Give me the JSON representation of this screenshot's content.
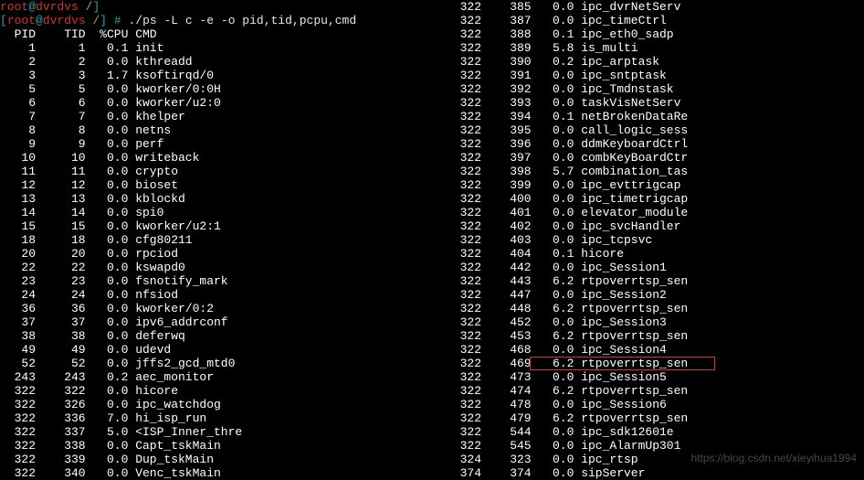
{
  "prompt": {
    "line0": {
      "user": "root",
      "at": "@",
      "host": "dvrdvs",
      "path": " /",
      "close": "]"
    },
    "line1": {
      "bracket_open": "[",
      "user": "root",
      "at": "@",
      "host": "dvrdvs",
      "path": " /",
      "bracket_close": "]",
      "hash": " # ",
      "command": "./ps -L c -e -o pid,tid,pcpu,cmd"
    }
  },
  "header": {
    "pid": "PID",
    "tid": "TID",
    "pcpu": "%CPU",
    "cmd": "CMD"
  },
  "left_rows": [
    {
      "pid": "1",
      "tid": "1",
      "pcpu": "0.1",
      "cmd": "init"
    },
    {
      "pid": "2",
      "tid": "2",
      "pcpu": "0.0",
      "cmd": "kthreadd"
    },
    {
      "pid": "3",
      "tid": "3",
      "pcpu": "1.7",
      "cmd": "ksoftirqd/0"
    },
    {
      "pid": "5",
      "tid": "5",
      "pcpu": "0.0",
      "cmd": "kworker/0:0H"
    },
    {
      "pid": "6",
      "tid": "6",
      "pcpu": "0.0",
      "cmd": "kworker/u2:0"
    },
    {
      "pid": "7",
      "tid": "7",
      "pcpu": "0.0",
      "cmd": "khelper"
    },
    {
      "pid": "8",
      "tid": "8",
      "pcpu": "0.0",
      "cmd": "netns"
    },
    {
      "pid": "9",
      "tid": "9",
      "pcpu": "0.0",
      "cmd": "perf"
    },
    {
      "pid": "10",
      "tid": "10",
      "pcpu": "0.0",
      "cmd": "writeback"
    },
    {
      "pid": "11",
      "tid": "11",
      "pcpu": "0.0",
      "cmd": "crypto"
    },
    {
      "pid": "12",
      "tid": "12",
      "pcpu": "0.0",
      "cmd": "bioset"
    },
    {
      "pid": "13",
      "tid": "13",
      "pcpu": "0.0",
      "cmd": "kblockd"
    },
    {
      "pid": "14",
      "tid": "14",
      "pcpu": "0.0",
      "cmd": "spi0"
    },
    {
      "pid": "15",
      "tid": "15",
      "pcpu": "0.0",
      "cmd": "kworker/u2:1"
    },
    {
      "pid": "18",
      "tid": "18",
      "pcpu": "0.0",
      "cmd": "cfg80211"
    },
    {
      "pid": "20",
      "tid": "20",
      "pcpu": "0.0",
      "cmd": "rpciod"
    },
    {
      "pid": "22",
      "tid": "22",
      "pcpu": "0.0",
      "cmd": "kswapd0"
    },
    {
      "pid": "23",
      "tid": "23",
      "pcpu": "0.0",
      "cmd": "fsnotify_mark"
    },
    {
      "pid": "24",
      "tid": "24",
      "pcpu": "0.0",
      "cmd": "nfsiod"
    },
    {
      "pid": "36",
      "tid": "36",
      "pcpu": "0.0",
      "cmd": "kworker/0:2"
    },
    {
      "pid": "37",
      "tid": "37",
      "pcpu": "0.0",
      "cmd": "ipv6_addrconf"
    },
    {
      "pid": "38",
      "tid": "38",
      "pcpu": "0.0",
      "cmd": "deferwq"
    },
    {
      "pid": "49",
      "tid": "49",
      "pcpu": "0.0",
      "cmd": "udevd"
    },
    {
      "pid": "52",
      "tid": "52",
      "pcpu": "0.0",
      "cmd": "jffs2_gcd_mtd0"
    },
    {
      "pid": "243",
      "tid": "243",
      "pcpu": "0.2",
      "cmd": "aec_monitor"
    },
    {
      "pid": "322",
      "tid": "322",
      "pcpu": "0.0",
      "cmd": "hicore"
    },
    {
      "pid": "322",
      "tid": "326",
      "pcpu": "0.0",
      "cmd": "ipc_watchdog"
    },
    {
      "pid": "322",
      "tid": "336",
      "pcpu": "7.0",
      "cmd": "hi_isp_run"
    },
    {
      "pid": "322",
      "tid": "337",
      "pcpu": "5.0",
      "cmd": "<ISP_Inner_thre"
    },
    {
      "pid": "322",
      "tid": "338",
      "pcpu": "0.0",
      "cmd": "Capt_tskMain"
    },
    {
      "pid": "322",
      "tid": "339",
      "pcpu": "0.0",
      "cmd": "Dup_tskMain"
    },
    {
      "pid": "322",
      "tid": "340",
      "pcpu": "0.0",
      "cmd": "Venc_tskMain"
    }
  ],
  "right_rows": [
    {
      "pid": "322",
      "tid": "385",
      "pcpu": "0.0",
      "cmd": "ipc_dvrNetServ"
    },
    {
      "pid": "322",
      "tid": "387",
      "pcpu": "0.0",
      "cmd": "ipc_timeCtrl"
    },
    {
      "pid": "322",
      "tid": "388",
      "pcpu": "0.1",
      "cmd": "ipc_eth0_sadp"
    },
    {
      "pid": "322",
      "tid": "389",
      "pcpu": "5.8",
      "cmd": "is_multi"
    },
    {
      "pid": "322",
      "tid": "390",
      "pcpu": "0.2",
      "cmd": "ipc_arptask"
    },
    {
      "pid": "322",
      "tid": "391",
      "pcpu": "0.0",
      "cmd": "ipc_sntptask"
    },
    {
      "pid": "322",
      "tid": "392",
      "pcpu": "0.0",
      "cmd": "ipc_Tmdnstask"
    },
    {
      "pid": "322",
      "tid": "393",
      "pcpu": "0.0",
      "cmd": "taskVisNetServ"
    },
    {
      "pid": "322",
      "tid": "394",
      "pcpu": "0.1",
      "cmd": "netBrokenDataRe"
    },
    {
      "pid": "322",
      "tid": "395",
      "pcpu": "0.0",
      "cmd": "call_logic_sess"
    },
    {
      "pid": "322",
      "tid": "396",
      "pcpu": "0.0",
      "cmd": "ddmKeyboardCtrl"
    },
    {
      "pid": "322",
      "tid": "397",
      "pcpu": "0.0",
      "cmd": "combKeyBoardCtr"
    },
    {
      "pid": "322",
      "tid": "398",
      "pcpu": "5.7",
      "cmd": "combination_tas"
    },
    {
      "pid": "322",
      "tid": "399",
      "pcpu": "0.0",
      "cmd": "ipc_evttrigcap"
    },
    {
      "pid": "322",
      "tid": "400",
      "pcpu": "0.0",
      "cmd": "ipc_timetrigcap"
    },
    {
      "pid": "322",
      "tid": "401",
      "pcpu": "0.0",
      "cmd": "elevator_module"
    },
    {
      "pid": "322",
      "tid": "402",
      "pcpu": "0.0",
      "cmd": "ipc_svcHandler"
    },
    {
      "pid": "322",
      "tid": "403",
      "pcpu": "0.0",
      "cmd": "ipc_tcpsvc"
    },
    {
      "pid": "322",
      "tid": "404",
      "pcpu": "0.1",
      "cmd": "hicore"
    },
    {
      "pid": "322",
      "tid": "442",
      "pcpu": "0.0",
      "cmd": "ipc_Session1"
    },
    {
      "pid": "322",
      "tid": "443",
      "pcpu": "6.2",
      "cmd": "rtpoverrtsp_sen"
    },
    {
      "pid": "322",
      "tid": "447",
      "pcpu": "0.0",
      "cmd": "ipc_Session2"
    },
    {
      "pid": "322",
      "tid": "448",
      "pcpu": "6.2",
      "cmd": "rtpoverrtsp_sen"
    },
    {
      "pid": "322",
      "tid": "452",
      "pcpu": "0.0",
      "cmd": "ipc_Session3"
    },
    {
      "pid": "322",
      "tid": "453",
      "pcpu": "6.2",
      "cmd": "rtpoverrtsp_sen"
    },
    {
      "pid": "322",
      "tid": "468",
      "pcpu": "0.0",
      "cmd": "ipc_Session4"
    },
    {
      "pid": "322",
      "tid": "469",
      "pcpu": "6.2",
      "cmd": "rtpoverrtsp_sen"
    },
    {
      "pid": "322",
      "tid": "473",
      "pcpu": "0.0",
      "cmd": "ipc_Session5"
    },
    {
      "pid": "322",
      "tid": "474",
      "pcpu": "6.2",
      "cmd": "rtpoverrtsp_sen"
    },
    {
      "pid": "322",
      "tid": "478",
      "pcpu": "0.0",
      "cmd": "ipc_Session6"
    },
    {
      "pid": "322",
      "tid": "479",
      "pcpu": "6.2",
      "cmd": "rtpoverrtsp_sen"
    },
    {
      "pid": "322",
      "tid": "544",
      "pcpu": "0.0",
      "cmd": "ipc_sdk12601e"
    },
    {
      "pid": "322",
      "tid": "545",
      "pcpu": "0.0",
      "cmd": "ipc_AlarmUp301"
    },
    {
      "pid": "324",
      "tid": "323",
      "pcpu": "0.0",
      "cmd": "ipc_rtsp"
    },
    {
      "pid": "374",
      "tid": "374",
      "pcpu": "0.0",
      "cmd": "sipServer"
    }
  ],
  "highlight": {
    "row_index": 26
  },
  "watermark": "https://blog.csdn.net/xieyihua1994"
}
